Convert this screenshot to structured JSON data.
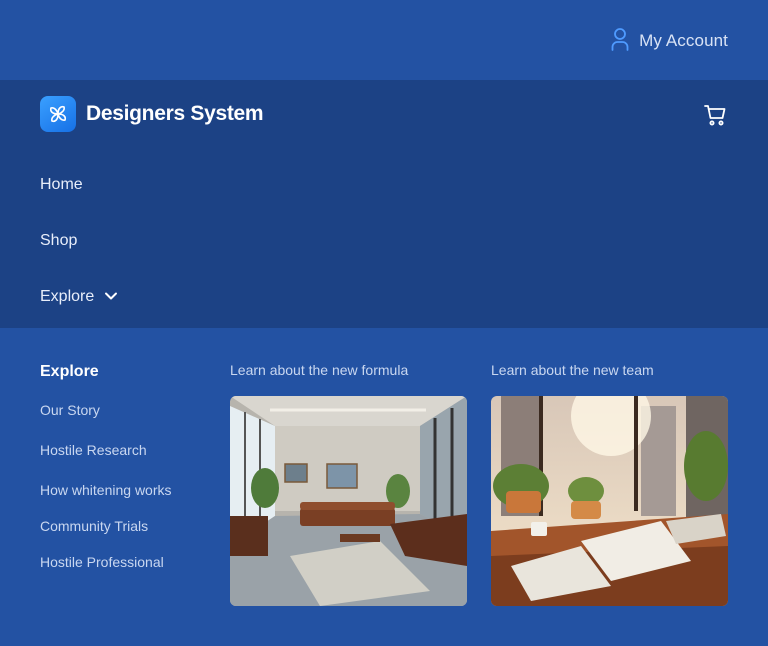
{
  "topbar": {
    "account_label": "My Account",
    "account_icon": "user-icon"
  },
  "header": {
    "brand_name": "Designers System",
    "logo_icon": "pinwheel-logo-icon",
    "cart_icon": "shopping-cart-icon"
  },
  "nav": {
    "items": [
      {
        "label": "Home"
      },
      {
        "label": "Shop"
      },
      {
        "label": "Explore",
        "icon": "chevron-down-icon"
      }
    ]
  },
  "explore_menu": {
    "heading": "Explore",
    "links": [
      {
        "label": "Our Story"
      },
      {
        "label": "Hostile Research"
      },
      {
        "label": "How whitening works"
      },
      {
        "label": "Community Trials"
      },
      {
        "label": "Hostile Professional"
      }
    ],
    "features": [
      {
        "title": "Learn about the new formula"
      },
      {
        "title": "Learn about the new team"
      }
    ]
  },
  "colors": {
    "background": "#2352a3",
    "nav_panel": "#1c4285",
    "logo_gradient_start": "#3aa0ff",
    "logo_gradient_end": "#1670e6",
    "link_text": "#c9d7f0"
  }
}
